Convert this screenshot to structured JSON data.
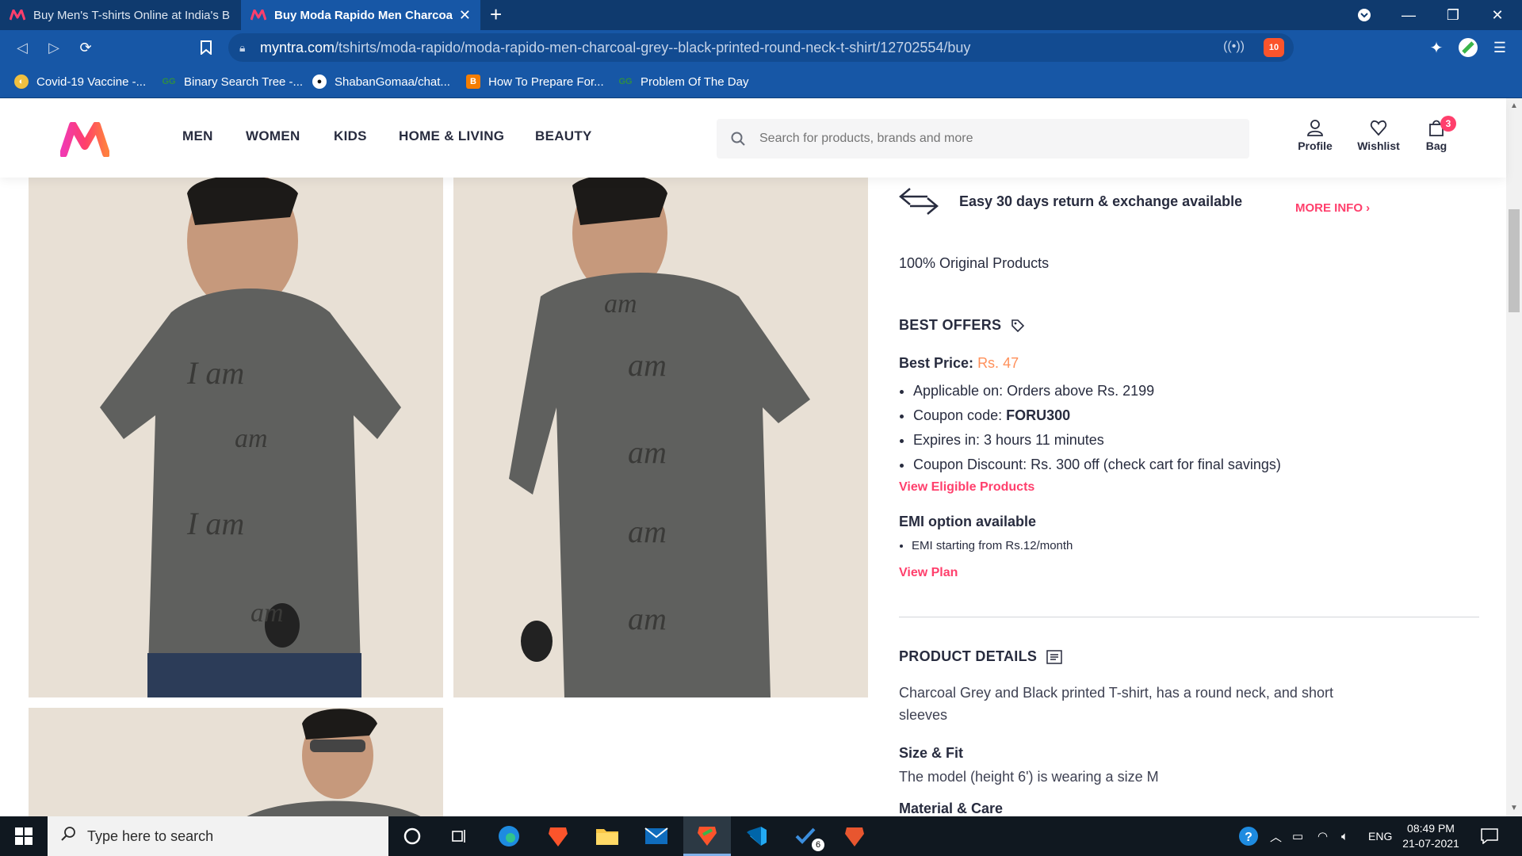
{
  "browser": {
    "tabs": [
      {
        "title": "Buy Men's T-shirts Online at India's Be",
        "active": false
      },
      {
        "title": "Buy Moda Rapido Men Charcoal G",
        "active": true
      }
    ],
    "url_host": "myntra.com",
    "url_path": "/tshirts/moda-rapido/moda-rapido-men-charcoal-grey--black-printed-round-neck-t-shirt/12702554/buy",
    "brave_shield_count": "10",
    "bookmarks": [
      {
        "label": "Covid-19 Vaccine -...",
        "icon": "vaccine-icon"
      },
      {
        "label": "Binary Search Tree -...",
        "icon": "gfg-icon"
      },
      {
        "label": "ShabanGomaa/chat...",
        "icon": "github-icon"
      },
      {
        "label": "How To Prepare For...",
        "icon": "blogger-icon"
      },
      {
        "label": "Problem Of The Day",
        "icon": "gfg-icon"
      }
    ]
  },
  "header": {
    "nav": [
      "MEN",
      "WOMEN",
      "KIDS",
      "HOME & LIVING",
      "BEAUTY"
    ],
    "search_placeholder": "Search for products, brands and more",
    "actions": {
      "profile": "Profile",
      "wishlist": "Wishlist",
      "bag": "Bag",
      "bag_count": "3"
    },
    "brand_color": "#ff3f6c"
  },
  "product": {
    "return_text": "Easy 30 days return & exchange available",
    "more_info": "MORE INFO",
    "original": "100% Original Products",
    "best_offers_title": "BEST OFFERS",
    "best_price_label": "Best Price:",
    "best_price_value": "Rs. 47",
    "offer_lines": {
      "applicable": "Applicable on: Orders above Rs. 2199",
      "coupon_label": "Coupon code:",
      "coupon_code": "FORU300",
      "expires": "Expires in: 3 hours 11 minutes",
      "discount": "Coupon Discount: Rs. 300 off (check cart for final savings)"
    },
    "view_eligible": "View Eligible Products",
    "emi_title": "EMI option available",
    "emi_line": "EMI starting from Rs.12/month",
    "view_plan": "View Plan",
    "details_title": "PRODUCT DETAILS",
    "description": "Charcoal Grey and Black printed T-shirt, has a round neck, and short sleeves",
    "size_fit_title": "Size & Fit",
    "size_fit": "The model (height 6') is wearing a size M",
    "material_title": "Material & Care"
  },
  "taskbar": {
    "search_placeholder": "Type here to search",
    "lang": "ENG",
    "time": "08:49 PM",
    "date": "21-07-2021",
    "todo_badge": "6"
  }
}
